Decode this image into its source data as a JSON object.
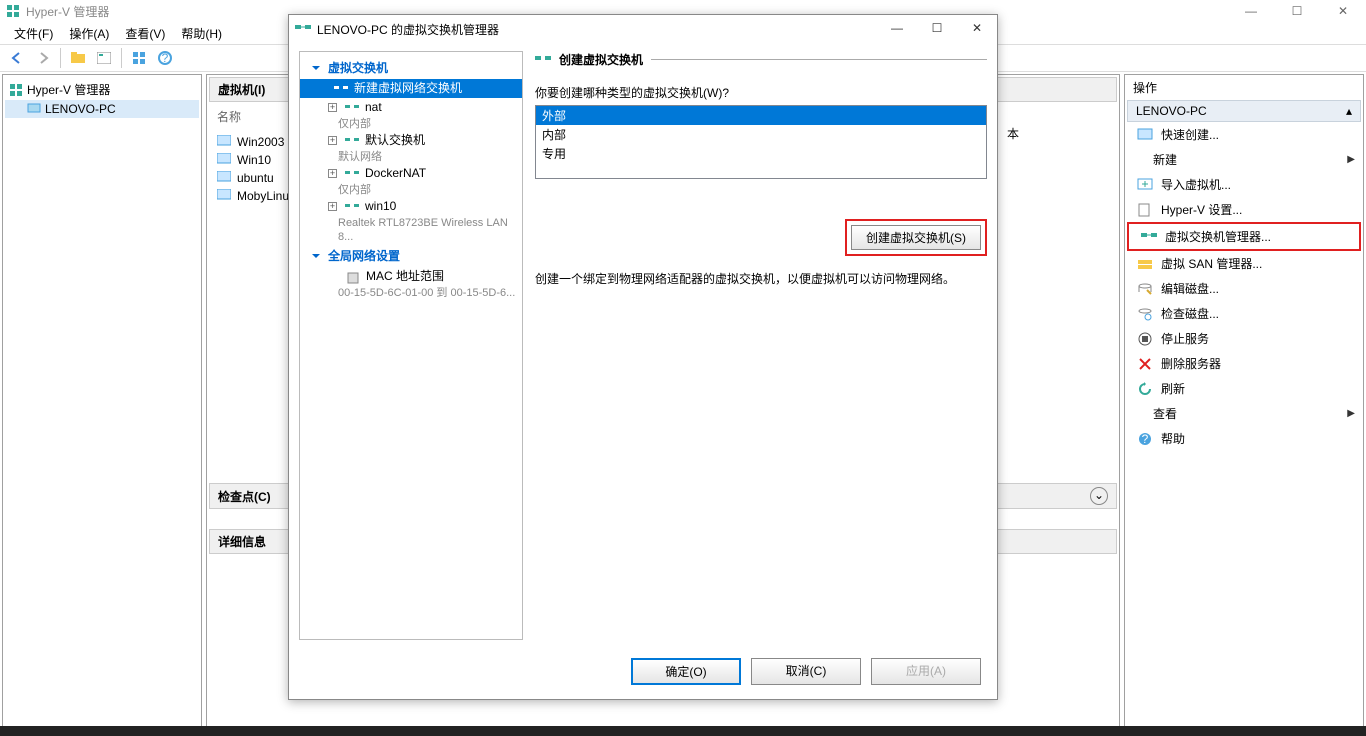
{
  "main": {
    "title": "Hyper-V 管理器",
    "menus": {
      "file": "文件(F)",
      "action": "操作(A)",
      "view": "查看(V)",
      "help": "帮助(H)"
    },
    "tree": {
      "root": "Hyper-V 管理器",
      "node": "LENOVO-PC"
    },
    "middle": {
      "vm_header": "虚拟机(I)",
      "col_name": "名称",
      "vms": [
        "Win2003",
        "Win10",
        "ubuntu",
        "MobyLinux"
      ],
      "text_fragment": "本",
      "checkpoint_header": "检查点(C)",
      "detail_header": "详细信息"
    },
    "right": {
      "title": "操作",
      "subhead": "LENOVO-PC",
      "actions": {
        "quick_create": "快速创建...",
        "new": "新建",
        "import_vm": "导入虚拟机...",
        "hv_settings": "Hyper-V 设置...",
        "vswitch_mgr": "虚拟交换机管理器...",
        "vsan_mgr": "虚拟 SAN 管理器...",
        "edit_disk": "编辑磁盘...",
        "inspect_disk": "检查磁盘...",
        "stop_svc": "停止服务",
        "del_server": "删除服务器",
        "refresh": "刷新",
        "view": "查看",
        "help": "帮助"
      }
    }
  },
  "dialog": {
    "title": "LENOVO-PC 的虚拟交换机管理器",
    "lefttree": {
      "group_switches": "虚拟交换机",
      "new_switch": "新建虚拟网络交换机",
      "nodes": [
        {
          "name": "nat",
          "sub": "仅内部"
        },
        {
          "name": "默认交换机",
          "sub": "默认网络"
        },
        {
          "name": "DockerNAT",
          "sub": "仅内部"
        },
        {
          "name": "win10",
          "sub": "Realtek RTL8723BE Wireless LAN 8..."
        }
      ],
      "group_global": "全局网络设置",
      "mac_range": "MAC 地址范围",
      "mac_sub": "00-15-5D-6C-01-00 到 00-15-5D-6..."
    },
    "right": {
      "section_title": "创建虚拟交换机",
      "prompt": "你要创建哪种类型的虚拟交换机(W)?",
      "types": {
        "external": "外部",
        "internal": "内部",
        "private": "专用"
      },
      "create_btn": "创建虚拟交换机(S)",
      "description": "创建一个绑定到物理网络适配器的虚拟交换机，以便虚拟机可以访问物理网络。"
    },
    "footer": {
      "ok": "确定(O)",
      "cancel": "取消(C)",
      "apply": "应用(A)"
    }
  }
}
